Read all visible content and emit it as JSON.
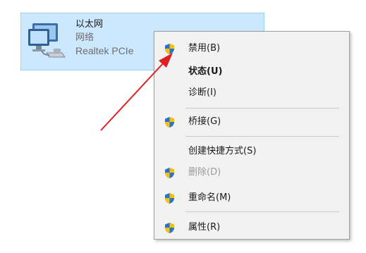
{
  "adapter": {
    "name": "以太网",
    "type": "网络",
    "device": "Realtek PCIe"
  },
  "menu": {
    "items": [
      {
        "label": "禁用(B)",
        "icon": "uac-shield-icon",
        "bold": false,
        "disabled": false
      },
      {
        "label": "状态(U)",
        "icon": "",
        "bold": true,
        "disabled": false
      },
      {
        "label": "诊断(I)",
        "icon": "",
        "bold": false,
        "disabled": false
      },
      {
        "label": "桥接(G)",
        "icon": "uac-shield-icon",
        "bold": false,
        "disabled": false
      },
      {
        "label": "创建快捷方式(S)",
        "icon": "",
        "bold": false,
        "disabled": false
      },
      {
        "label": "删除(D)",
        "icon": "uac-shield-icon",
        "bold": false,
        "disabled": true
      },
      {
        "label": "重命名(M)",
        "icon": "uac-shield-icon",
        "bold": false,
        "disabled": false
      },
      {
        "label": "属性(R)",
        "icon": "uac-shield-icon",
        "bold": false,
        "disabled": false
      }
    ]
  },
  "colors": {
    "selection_bg": "#cce8ff",
    "selection_border": "#99d1ff",
    "menu_bg": "#f2f2f2",
    "arrow": "#e02020",
    "shield_blue": "#2a6fd6",
    "shield_yellow": "#f5c400"
  }
}
